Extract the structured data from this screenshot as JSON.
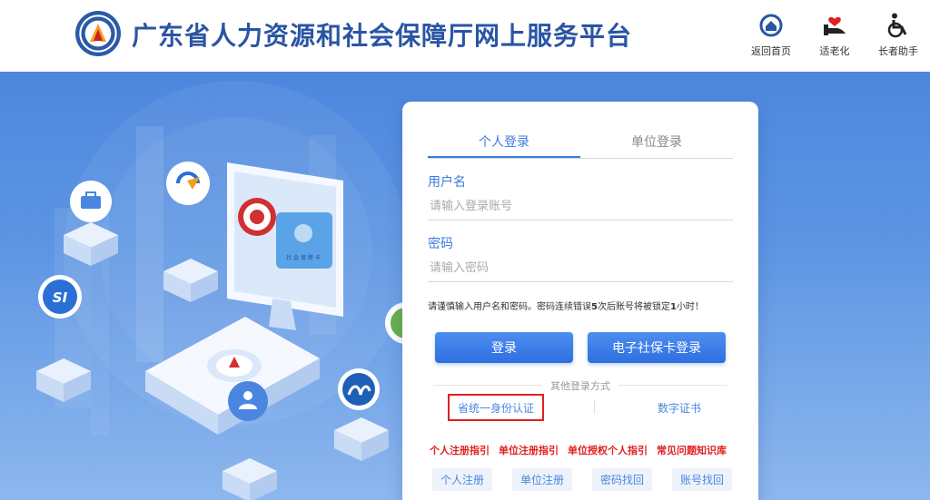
{
  "header": {
    "title": "广东省人力资源和社会保障厅网上服务平台",
    "nav": [
      {
        "label": "返回首页",
        "icon": "home-icon"
      },
      {
        "label": "适老化",
        "icon": "elderly-care-icon"
      },
      {
        "label": "长者助手",
        "icon": "wheelchair-icon"
      }
    ]
  },
  "illustration": {
    "app_badges": [
      "SI"
    ],
    "screen_card_text": "社 会 保 障 卡"
  },
  "login": {
    "tabs": [
      "个人登录",
      "单位登录"
    ],
    "active_tab": 0,
    "username_label": "用户名",
    "username_placeholder": "请输入登录账号",
    "password_label": "密码",
    "password_placeholder": "请输入密码",
    "warning_pre": "请谨慎输入用户名和密码。密码连续错误",
    "warning_count": "5",
    "warning_mid": "次后账号将被锁定",
    "warning_hours": "1",
    "warning_post": "小时！",
    "login_button": "登录",
    "card_login_button": "电子社保卡登录",
    "other_methods_title": "其他登录方式",
    "other_methods": [
      "省统一身份认证",
      "数字证书"
    ],
    "guides": [
      "个人注册指引",
      "单位注册指引",
      "单位授权个人指引",
      "常见问题知识库"
    ],
    "bottom_links": [
      "个人注册",
      "单位注册",
      "密码找回",
      "账号找回"
    ]
  },
  "colors": {
    "brand": "#2a55a4",
    "accent": "#3a7be0",
    "banner": "#5d95e3",
    "alert": "#e02020"
  }
}
